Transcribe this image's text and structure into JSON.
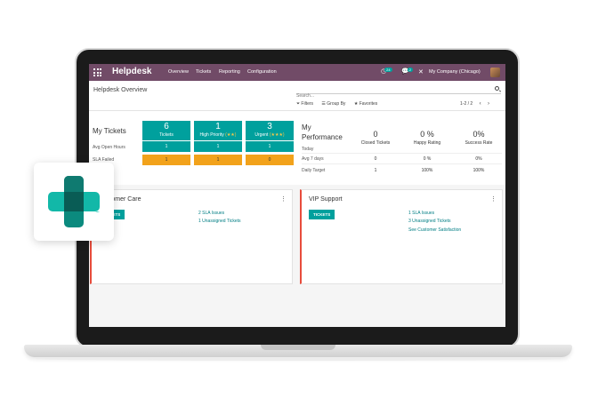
{
  "navbar": {
    "app_name": "Helpdesk",
    "menu": [
      "Overview",
      "Tickets",
      "Reporting",
      "Configuration"
    ],
    "activity_badge": "24",
    "messages_badge": "2",
    "close_glyph": "✕",
    "company": "My Company (Chicago)"
  },
  "control_panel": {
    "breadcrumb": "Helpdesk Overview",
    "search_placeholder": "Search...",
    "filters_label": "Filters",
    "group_by_label": "Group By",
    "favorites_label": "Favorites",
    "pager": "1-2 / 2"
  },
  "my_tickets": {
    "title": "My Tickets",
    "row_labels": [
      "Avg Open Hours",
      "SLA Failed"
    ],
    "columns": [
      {
        "count": "6",
        "label": "Tickets",
        "stars": "",
        "avg_open_hours": "1",
        "sla_failed": "1"
      },
      {
        "count": "1",
        "label": "High Priority",
        "stars": "(★★)",
        "avg_open_hours": "1",
        "sla_failed": "1"
      },
      {
        "count": "3",
        "label": "Urgent",
        "stars": "(★★★)",
        "avg_open_hours": "1",
        "sla_failed": "0"
      }
    ]
  },
  "my_performance": {
    "title_line1": "My",
    "title_line2": "Performance",
    "row_labels": [
      "Today",
      "Avg 7 days",
      "Daily Target"
    ],
    "columns": [
      {
        "head": "0",
        "label": "Closed Tickets",
        "avg7": "0",
        "target": "1"
      },
      {
        "head": "0 %",
        "label": "Happy Rating",
        "avg7": "0 %",
        "target": "100%"
      },
      {
        "head": "0%",
        "label": "Success Rate",
        "avg7": "0%",
        "target": "100%"
      }
    ]
  },
  "teams": [
    {
      "name": "Customer Care",
      "button": "TICKETS",
      "links": [
        "2 SLA Issues",
        "1 Unassigned Tickets"
      ]
    },
    {
      "name": "VIP Support",
      "button": "TICKETS",
      "links": [
        "1 SLA Issues",
        "3 Unassigned Tickets",
        "See Customer Satisfaction"
      ]
    }
  ],
  "colors": {
    "brand": "#714b67",
    "teal": "#00a09d",
    "orange": "#f2a21b",
    "link": "#017e84",
    "card_accent": "#e74c3c"
  },
  "icons": {
    "apps": "apps-grid-icon",
    "search": "search-icon",
    "filter": "filter-icon",
    "group_by": "list-icon",
    "favorites": "star-icon",
    "pager_prev": "chevron-left-icon",
    "pager_next": "chevron-right-icon",
    "helpdesk_logo": "helpdesk-cross-logo-icon"
  }
}
